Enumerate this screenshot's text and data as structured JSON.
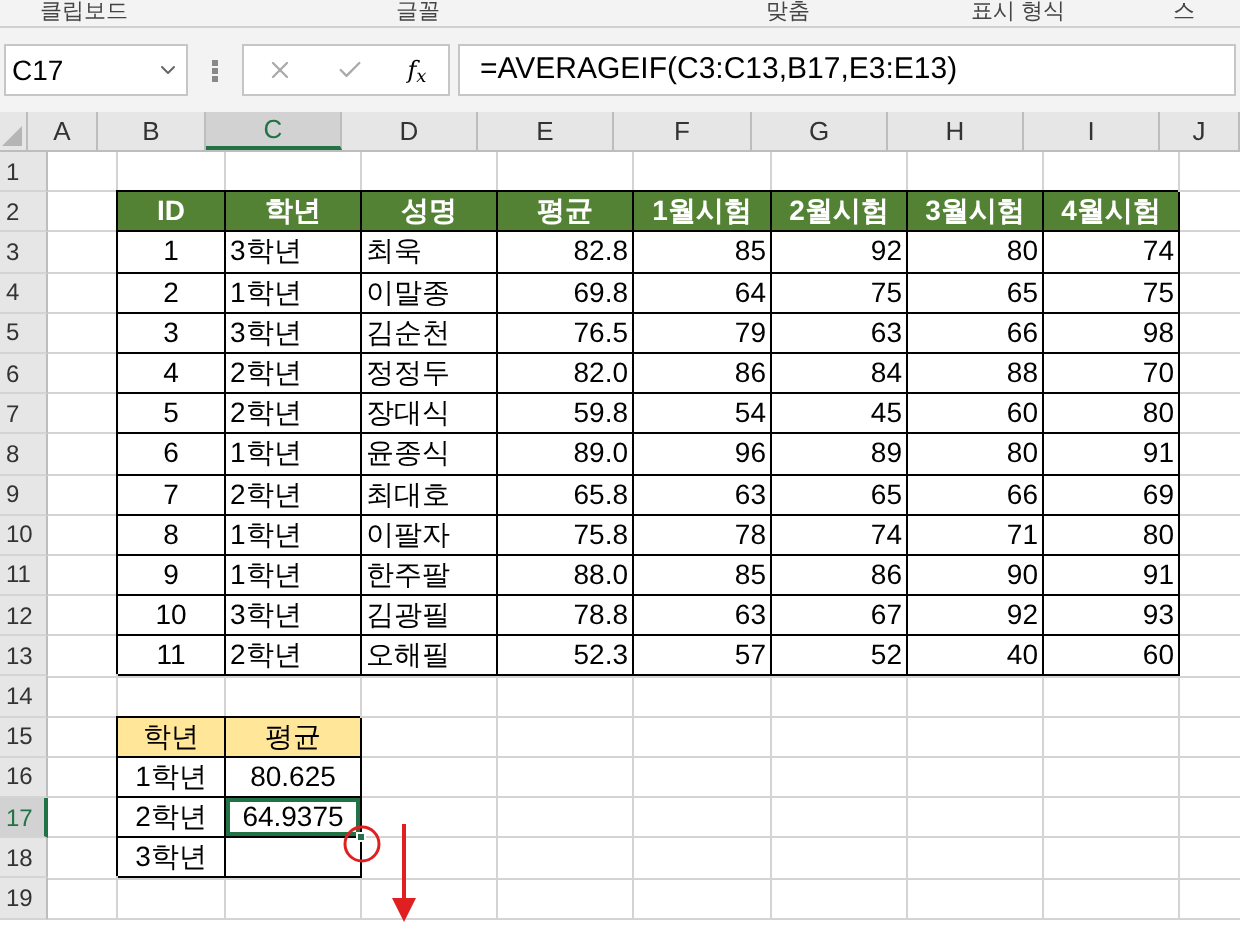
{
  "ribbon_groups": [
    "클립보드",
    "글꼴",
    "맞춤",
    "표시 형식",
    "스"
  ],
  "name_box": "C17",
  "function_label": "f$_{x}$",
  "formula": "=AVERAGEIF(C3:C13,B17,E3:E13)",
  "columns": [
    {
      "label": "A",
      "selected": false
    },
    {
      "label": "B",
      "selected": false
    },
    {
      "label": "C",
      "selected": true
    },
    {
      "label": "D",
      "selected": false
    },
    {
      "label": "E",
      "selected": false
    },
    {
      "label": "F",
      "selected": false
    },
    {
      "label": "G",
      "selected": false
    },
    {
      "label": "H",
      "selected": false
    },
    {
      "label": "I",
      "selected": false
    },
    {
      "label": "J",
      "selected": false
    }
  ],
  "rows": [
    {
      "label": "1",
      "selected": false
    },
    {
      "label": "2",
      "selected": false
    },
    {
      "label": "3",
      "selected": false
    },
    {
      "label": "4",
      "selected": false
    },
    {
      "label": "5",
      "selected": false
    },
    {
      "label": "6",
      "selected": false
    },
    {
      "label": "7",
      "selected": false
    },
    {
      "label": "8",
      "selected": false
    },
    {
      "label": "9",
      "selected": false
    },
    {
      "label": "10",
      "selected": false
    },
    {
      "label": "11",
      "selected": false
    },
    {
      "label": "12",
      "selected": false
    },
    {
      "label": "13",
      "selected": false
    },
    {
      "label": "14",
      "selected": false
    },
    {
      "label": "15",
      "selected": false
    },
    {
      "label": "16",
      "selected": false
    },
    {
      "label": "17",
      "selected": true
    },
    {
      "label": "18",
      "selected": false
    },
    {
      "label": "19",
      "selected": false
    }
  ],
  "table": {
    "columns": [
      "ID",
      "학년",
      "성명",
      "평균",
      "1월시험",
      "2월시험",
      "3월시험",
      "4월시험"
    ],
    "rows": [
      [
        "1",
        "3학년",
        "최욱",
        "82.8",
        "85",
        "92",
        "80",
        "74"
      ],
      [
        "2",
        "1학년",
        "이말종",
        "69.8",
        "64",
        "75",
        "65",
        "75"
      ],
      [
        "3",
        "3학년",
        "김순천",
        "76.5",
        "79",
        "63",
        "66",
        "98"
      ],
      [
        "4",
        "2학년",
        "정정두",
        "82.0",
        "86",
        "84",
        "88",
        "70"
      ],
      [
        "5",
        "2학년",
        "장대식",
        "59.8",
        "54",
        "45",
        "60",
        "80"
      ],
      [
        "6",
        "1학년",
        "윤종식",
        "89.0",
        "96",
        "89",
        "80",
        "91"
      ],
      [
        "7",
        "2학년",
        "최대호",
        "65.8",
        "63",
        "65",
        "66",
        "69"
      ],
      [
        "8",
        "1학년",
        "이팔자",
        "75.8",
        "78",
        "74",
        "71",
        "80"
      ],
      [
        "9",
        "1학년",
        "한주팔",
        "88.0",
        "85",
        "86",
        "90",
        "91"
      ],
      [
        "10",
        "3학년",
        "김광필",
        "78.8",
        "63",
        "67",
        "92",
        "93"
      ],
      [
        "11",
        "2학년",
        "오해필",
        "52.3",
        "57",
        "52",
        "40",
        "60"
      ]
    ]
  },
  "summary": {
    "columns": [
      "학년",
      "평균"
    ],
    "rows": [
      {
        "cells": [
          "1학년",
          "80.625"
        ],
        "selected": false
      },
      {
        "cells": [
          "2학년",
          "64.9375"
        ],
        "selected": true
      },
      {
        "cells": [
          "3학년"
        ],
        "selected": false
      }
    ]
  }
}
